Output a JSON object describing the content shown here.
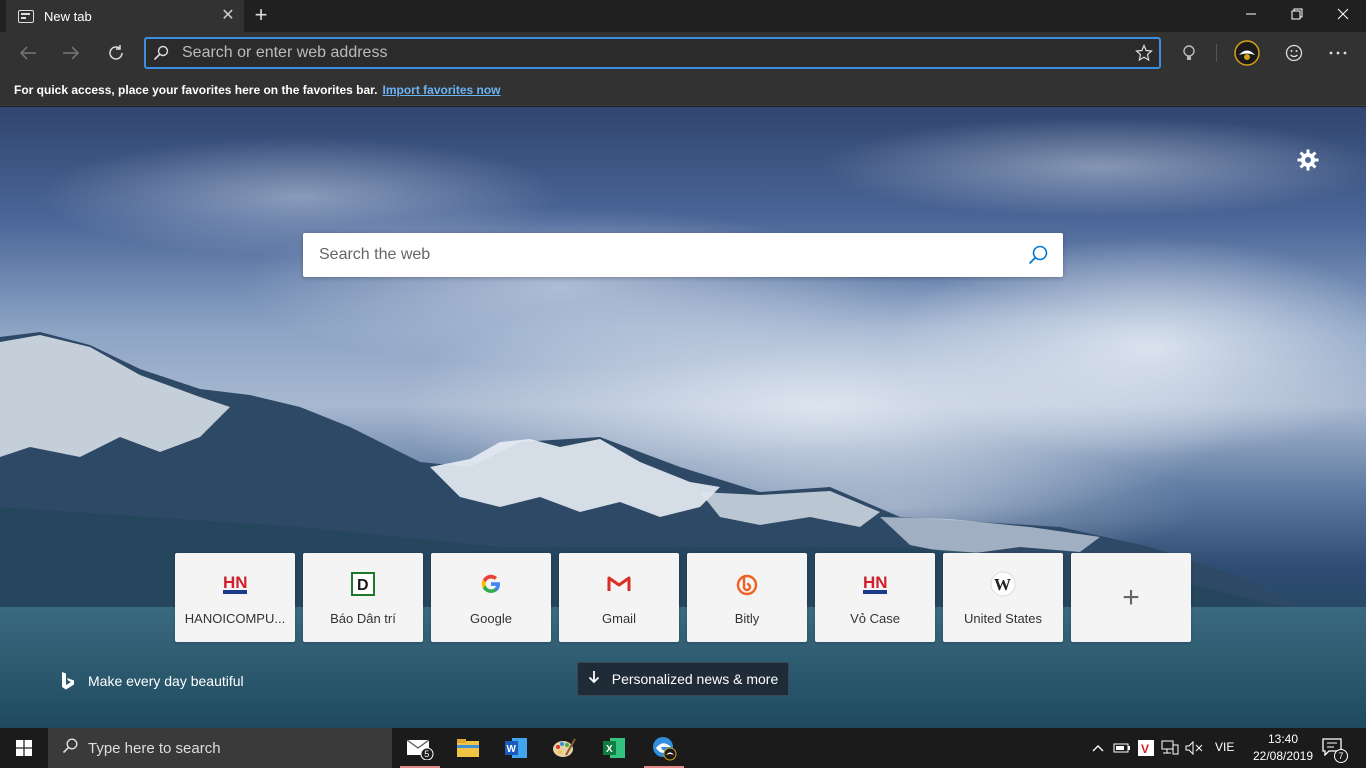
{
  "tab": {
    "title": "New tab",
    "favicon": "newtab-icon"
  },
  "window_controls": [
    "minimize-icon",
    "restore-icon",
    "close-icon"
  ],
  "addressbar": {
    "placeholder": "Search or enter web address"
  },
  "favorites_bar": {
    "message": "For quick access, place your favorites here on the favorites bar.",
    "link": "Import favorites now"
  },
  "newtab": {
    "search_placeholder": "Search the web",
    "tiles": [
      {
        "label": "HANOICOMPU...",
        "icon": "H",
        "icon_color": "#d21f2b"
      },
      {
        "label": "Báo Dân trí",
        "icon": "D",
        "icon_color": "#1d7a2c"
      },
      {
        "label": "Google",
        "icon": "G",
        "icon_color": "#4285f4"
      },
      {
        "label": "Gmail",
        "icon": "M",
        "icon_color": "#d93025"
      },
      {
        "label": "Bitly",
        "icon": "b",
        "icon_color": "#ee6123"
      },
      {
        "label": "Vỏ Case",
        "icon": "H",
        "icon_color": "#d21f2b"
      },
      {
        "label": "United States",
        "icon": "W",
        "icon_color": "#222222"
      }
    ],
    "bing_caption": "Make every day beautiful",
    "news_button": "Personalized news & more"
  },
  "taskbar": {
    "search_placeholder": "Type here to search",
    "mail_badge": "5",
    "language": "VIE",
    "time": "13:40",
    "date": "22/08/2019",
    "notification_count": "7"
  }
}
